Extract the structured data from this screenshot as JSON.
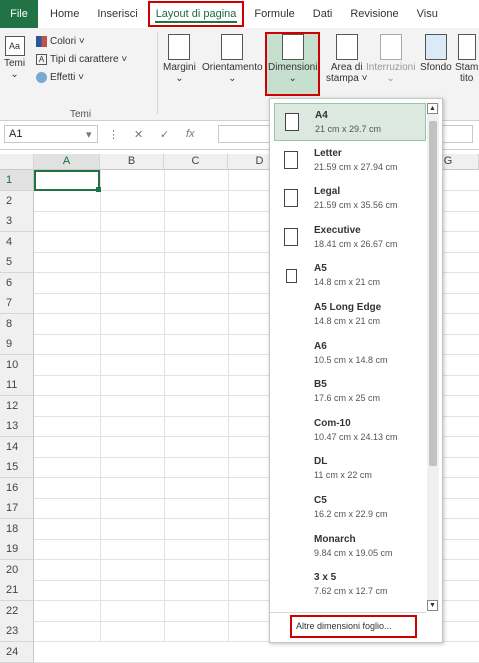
{
  "tabs": [
    "File",
    "Home",
    "Inserisci",
    "Layout di pagina",
    "Formule",
    "Dati",
    "Revisione",
    "Visu"
  ],
  "active_tab": "Layout di pagina",
  "ribbon": {
    "temi_label": "Temi",
    "colori_label": "Colori ˅",
    "tipi_label": "Tipi di carattere ˅",
    "effetti_label": "Effetti ˅",
    "group_temi": "Temi",
    "margini": "Margini",
    "orientamento": "Orientamento",
    "dimensioni": "Dimensioni",
    "area_di": "Area di",
    "stampa": "stampa ˅",
    "interruzioni": "Interruzioni",
    "sfondo": "Sfondo",
    "stampa_titoli": "Stam",
    "titoli": "tito"
  },
  "formula_bar": {
    "namebox": "A1",
    "fx": "fx"
  },
  "columns": [
    "A",
    "B",
    "C",
    "D",
    "G"
  ],
  "rows": [
    "1",
    "2",
    "3",
    "4",
    "5",
    "6",
    "7",
    "8",
    "9",
    "10",
    "11",
    "12",
    "13",
    "14",
    "15",
    "16",
    "17",
    "18",
    "19",
    "20",
    "21",
    "22",
    "23",
    "24"
  ],
  "paper_sizes": [
    {
      "name": "A4",
      "dims": "21 cm x 29.7 cm"
    },
    {
      "name": "Letter",
      "dims": "21.59 cm x 27.94 cm"
    },
    {
      "name": "Legal",
      "dims": "21.59 cm x 35.56 cm"
    },
    {
      "name": "Executive",
      "dims": "18.41 cm x 26.67 cm"
    },
    {
      "name": "A5",
      "dims": "14.8 cm x 21 cm"
    },
    {
      "name": "A5 Long Edge",
      "dims": "14.8 cm x 21 cm"
    },
    {
      "name": "A6",
      "dims": "10.5 cm x 14.8 cm"
    },
    {
      "name": "B5",
      "dims": "17.6 cm x 25 cm"
    },
    {
      "name": "Com-10",
      "dims": "10.47 cm x 24.13 cm"
    },
    {
      "name": "DL",
      "dims": "11 cm x 22 cm"
    },
    {
      "name": "C5",
      "dims": "16.2 cm x 22.9 cm"
    },
    {
      "name": "Monarch",
      "dims": "9.84 cm x 19.05 cm"
    },
    {
      "name": "3 x 5",
      "dims": "7.62 cm x 12.7 cm"
    }
  ],
  "more_sizes": "Altre dimensioni foglio...",
  "colors": {
    "excel_green": "#217346",
    "highlight_red": "#d00000"
  }
}
